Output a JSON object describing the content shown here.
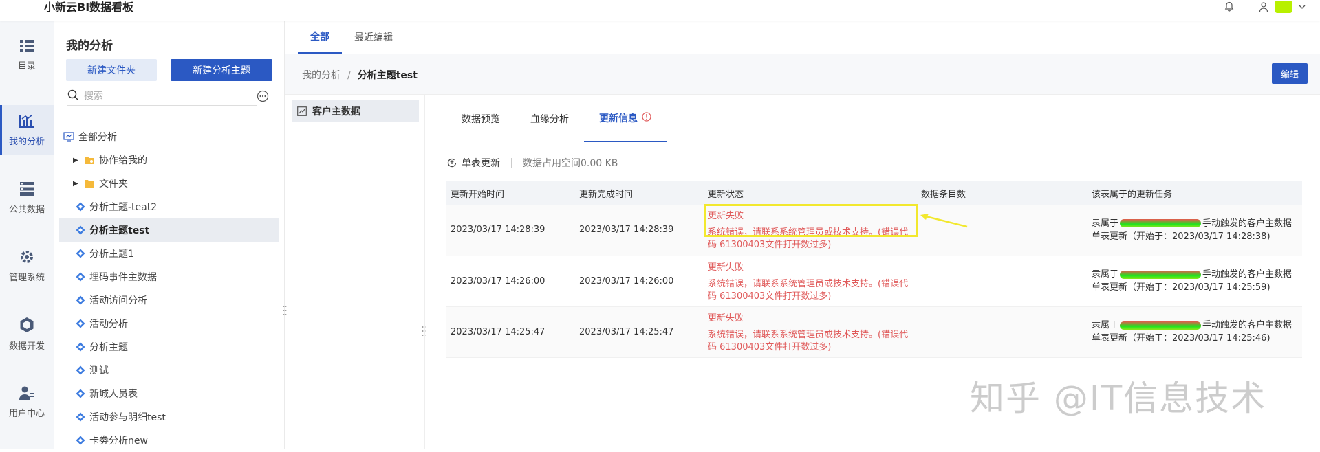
{
  "app": {
    "title": "小新云BI数据看板"
  },
  "colors": {
    "primary": "#2b59c3",
    "error": "#e05a5a",
    "highlight": "#f2e82e"
  },
  "topbar": {
    "icons": [
      "bell-icon",
      "user-icon",
      "chevron-down-icon"
    ]
  },
  "leftnav": {
    "items": [
      {
        "label": "目录",
        "icon": "catalog-icon"
      },
      {
        "label": "我的分析",
        "icon": "analysis-chart-icon"
      },
      {
        "label": "公共数据",
        "icon": "database-icon"
      },
      {
        "label": "管理系统",
        "icon": "gear-icon"
      },
      {
        "label": "数据开发",
        "icon": "cube-icon"
      },
      {
        "label": "用户中心",
        "icon": "users-icon"
      }
    ]
  },
  "tree_panel": {
    "title": "我的分析",
    "new_folder_label": "新建文件夹",
    "new_topic_label": "新建分析主题",
    "search_placeholder": "搜索",
    "items": [
      {
        "label": "全部分析"
      },
      {
        "label": "协作给我的"
      },
      {
        "label": "文件夹"
      },
      {
        "label": "分析主题-teat2"
      },
      {
        "label": "分析主题test"
      },
      {
        "label": "分析主题1"
      },
      {
        "label": "埋码事件主数据"
      },
      {
        "label": "活动访问分析"
      },
      {
        "label": "活动分析"
      },
      {
        "label": "分析主题"
      },
      {
        "label": "测试"
      },
      {
        "label": "新城人员表"
      },
      {
        "label": "活动参与明细test"
      },
      {
        "label": "卡劵分析new"
      }
    ]
  },
  "main": {
    "tabs": [
      {
        "label": "全部"
      },
      {
        "label": "最近编辑"
      }
    ],
    "breadcrumb": {
      "root": "我的分析",
      "separator": "/",
      "current": "分析主题test"
    },
    "edit_label": "编辑",
    "dataset_label": "客户主数据",
    "detail_tabs": [
      {
        "label": "数据预览"
      },
      {
        "label": "血缘分析"
      },
      {
        "label": "更新信息"
      }
    ],
    "toolbar": {
      "refresh_label": "单表更新",
      "usage_label": "数据占用空间0.00 KB"
    },
    "table": {
      "headers": [
        "更新开始时间",
        "更新完成时间",
        "更新状态",
        "数据条目数",
        "该表属于的更新任务"
      ],
      "rows": [
        {
          "start": "2023/03/17 14:28:39",
          "end": "2023/03/17 14:28:39",
          "status": "更新失败",
          "message": "系统错误，请联系系统管理员或技术支持。(错误代码 61300403文件打开数过多)",
          "count": "",
          "task_prefix": "隶属于",
          "task_suffix": "手动触发的客户主数据单表更新（开始于：2023/03/17 14:28:38)"
        },
        {
          "start": "2023/03/17 14:26:00",
          "end": "2023/03/17 14:26:00",
          "status": "更新失败",
          "message": "系统错误，请联系系统管理员或技术支持。(错误代码 61300403文件打开数过多)",
          "count": "",
          "task_prefix": "隶属于",
          "task_suffix": "手动触发的客户主数据单表更新（开始于：2023/03/17 14:25:59)"
        },
        {
          "start": "2023/03/17 14:25:47",
          "end": "2023/03/17 14:25:47",
          "status": "更新失败",
          "message": "系统错误，请联系系统管理员或技术支持。(错误代码 61300403文件打开数过多)",
          "count": "",
          "task_prefix": "隶属于",
          "task_suffix": "手动触发的客户主数据单表更新（开始于：2023/03/17 14:25:46)"
        }
      ]
    }
  },
  "watermark": "知乎 @IT信息技术"
}
